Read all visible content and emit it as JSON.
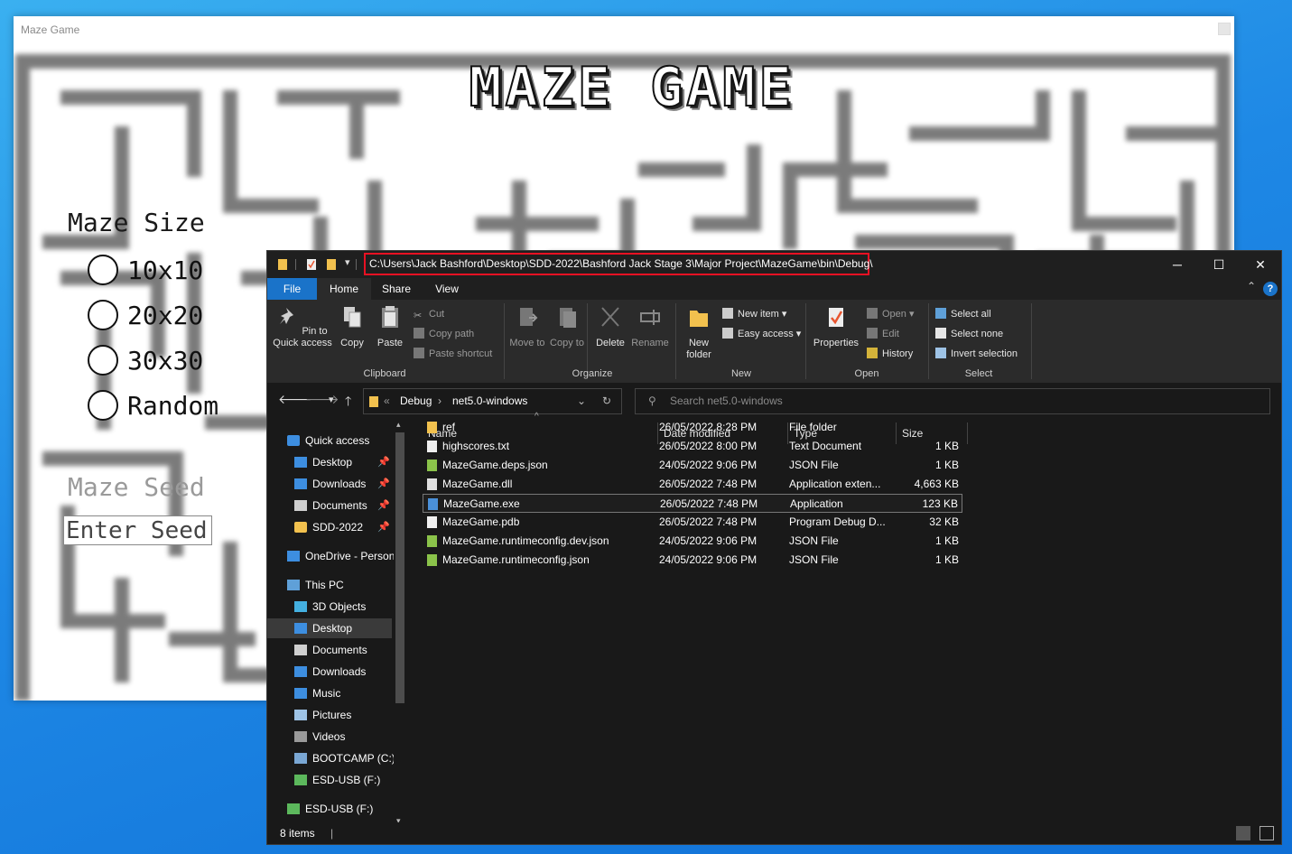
{
  "maze_window": {
    "title": "Maze Game",
    "heading": "MAZE GAME",
    "size_label": "Maze Size",
    "size_options": [
      "10x10",
      "20x20",
      "30x30",
      "Random"
    ],
    "seed_label": "Maze Seed",
    "seed_placeholder": "Enter Seed"
  },
  "explorer": {
    "path": "C:\\Users\\Jack Bashford\\Desktop\\SDD-2022\\Bashford Jack Stage 3\\Major Project\\MazeGame\\bin\\Debug\\",
    "tabs": [
      "File",
      "Home",
      "Share",
      "View"
    ],
    "help": "?",
    "ribbon": {
      "clipboard": {
        "label": "Clipboard",
        "pin": "Pin to Quick access",
        "copy": "Copy",
        "paste": "Paste",
        "cut": "Cut",
        "copy_path": "Copy path",
        "paste_shortcut": "Paste shortcut"
      },
      "organize": {
        "label": "Organize",
        "move_to": "Move to",
        "copy_to": "Copy to",
        "delete": "Delete",
        "rename": "Rename"
      },
      "new": {
        "label": "New",
        "new_folder": "New folder",
        "new_item": "New item",
        "easy_access": "Easy access"
      },
      "open": {
        "label": "Open",
        "properties": "Properties",
        "open": "Open",
        "edit": "Edit",
        "history": "History"
      },
      "select": {
        "label": "Select",
        "select_all": "Select all",
        "select_none": "Select none",
        "invert": "Invert selection"
      }
    },
    "breadcrumb": [
      "Debug",
      "net5.0-windows"
    ],
    "search_placeholder": "Search net5.0-windows",
    "sidebar": [
      {
        "label": "Quick access",
        "icon": "star-icon",
        "color": "#3d8ee0"
      },
      {
        "label": "Desktop",
        "icon": "desktop-icon",
        "color": "#3d8ee0",
        "pinned": true
      },
      {
        "label": "Downloads",
        "icon": "download-icon",
        "color": "#3d8ee0",
        "pinned": true
      },
      {
        "label": "Documents",
        "icon": "documents-icon",
        "color": "#cfcfcf",
        "pinned": true
      },
      {
        "label": "SDD-2022",
        "icon": "folder-icon",
        "color": "#f2c14e",
        "pinned": true
      },
      {
        "label": "OneDrive - Person",
        "icon": "cloud-icon",
        "color": "#3d8ee0"
      },
      {
        "label": "This PC",
        "icon": "computer-icon",
        "color": "#5fa0d8"
      },
      {
        "label": "3D Objects",
        "icon": "cube-icon",
        "color": "#44b0e0"
      },
      {
        "label": "Desktop",
        "icon": "desktop-icon",
        "color": "#3d8ee0",
        "selected": true
      },
      {
        "label": "Documents",
        "icon": "documents-icon",
        "color": "#cfcfcf"
      },
      {
        "label": "Downloads",
        "icon": "download-icon",
        "color": "#3d8ee0"
      },
      {
        "label": "Music",
        "icon": "music-icon",
        "color": "#3d8ee0"
      },
      {
        "label": "Pictures",
        "icon": "pictures-icon",
        "color": "#9ec3e6"
      },
      {
        "label": "Videos",
        "icon": "videos-icon",
        "color": "#9a9a9a"
      },
      {
        "label": "BOOTCAMP (C:)",
        "icon": "drive-icon",
        "color": "#7aa7d4"
      },
      {
        "label": "ESD-USB (F:)",
        "icon": "usb-icon",
        "color": "#5cb85c"
      },
      {
        "label": "ESD-USB (F:)",
        "icon": "usb-icon",
        "color": "#5cb85c"
      }
    ],
    "columns": [
      "Name",
      "Date modified",
      "Type",
      "Size"
    ],
    "files": [
      {
        "name": "ref",
        "date": "26/05/2022 8:28 PM",
        "type": "File folder",
        "size": "",
        "icon": "folder-icon"
      },
      {
        "name": "highscores.txt",
        "date": "26/05/2022 8:00 PM",
        "type": "Text Document",
        "size": "1 KB",
        "icon": "text-file-icon"
      },
      {
        "name": "MazeGame.deps.json",
        "date": "24/05/2022 9:06 PM",
        "type": "JSON File",
        "size": "1 KB",
        "icon": "json-file-icon"
      },
      {
        "name": "MazeGame.dll",
        "date": "26/05/2022 7:48 PM",
        "type": "Application exten...",
        "size": "4,663 KB",
        "icon": "dll-file-icon"
      },
      {
        "name": "MazeGame.exe",
        "date": "26/05/2022 7:48 PM",
        "type": "Application",
        "size": "123 KB",
        "icon": "exe-file-icon",
        "selected": true
      },
      {
        "name": "MazeGame.pdb",
        "date": "26/05/2022 7:48 PM",
        "type": "Program Debug D...",
        "size": "32 KB",
        "icon": "pdb-file-icon"
      },
      {
        "name": "MazeGame.runtimeconfig.dev.json",
        "date": "24/05/2022 9:06 PM",
        "type": "JSON File",
        "size": "1 KB",
        "icon": "json-file-icon"
      },
      {
        "name": "MazeGame.runtimeconfig.json",
        "date": "24/05/2022 9:06 PM",
        "type": "JSON File",
        "size": "1 KB",
        "icon": "json-file-icon"
      }
    ],
    "status": "8 items",
    "accent": "#1a73c9",
    "highlight_border": "#e81123"
  }
}
